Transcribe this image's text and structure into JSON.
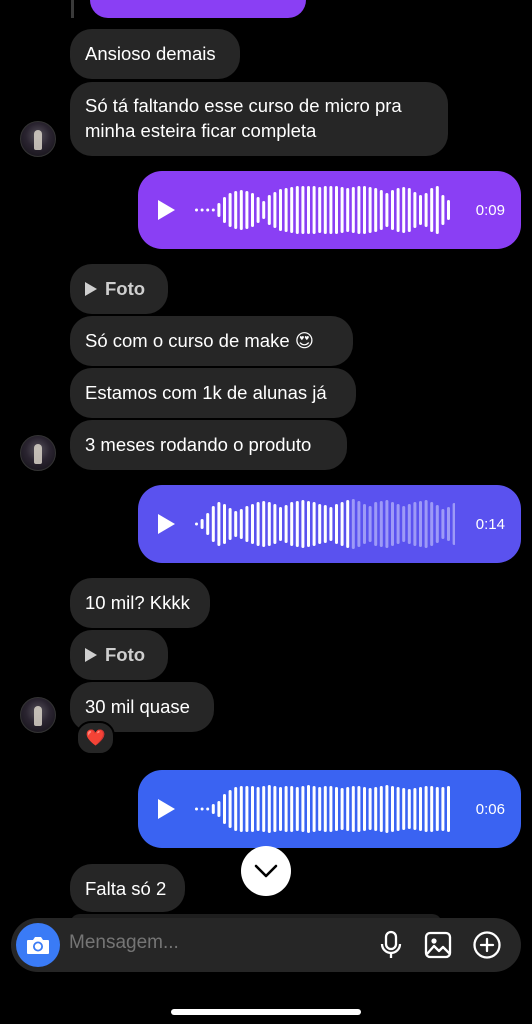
{
  "messages": {
    "m1": "Ansioso demais",
    "m2": "Só tá faltando esse curso de micro pra minha esteira ficar completa",
    "voice1_duration": "0:09",
    "foto1": "Foto",
    "m3": "Só com o curso de make 😍",
    "m4": "Estamos com 1k de alunas já",
    "m5": "3 meses rodando o produto",
    "voice2_duration": "0:14",
    "m6": "10 mil? Kkkk",
    "foto2": "Foto",
    "m7": "30 mil quase",
    "reaction": "❤️",
    "voice3_duration": "0:06",
    "m8": "Falta só 2"
  },
  "composer": {
    "placeholder": "Mensagem..."
  },
  "colors": {
    "voice1_bg": "#8a3ff4",
    "voice2_bg": "#5a52ef",
    "voice3_bg": "#3a63f2",
    "bubble_in": "#262626",
    "accent_blue": "#3a7bf6"
  },
  "icons": {
    "camera": "camera-icon",
    "mic": "microphone-icon",
    "gallery": "gallery-icon",
    "plus": "plus-circle-icon",
    "scroll": "chevron-down-icon"
  }
}
